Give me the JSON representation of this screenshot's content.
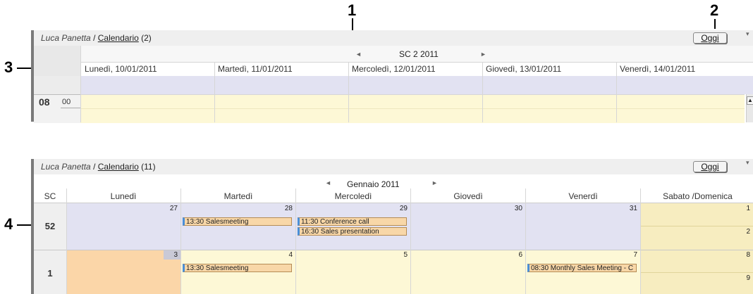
{
  "callouts": {
    "c1": "1",
    "c2": "2",
    "c3": "3",
    "c4": "4"
  },
  "top_panel": {
    "user": "Luca Panetta",
    "separator": " / ",
    "calendar_link": "Calendario",
    "count": "(2)",
    "today_button": "Oggi",
    "period": "SC 2 2011",
    "days": [
      "Lunedì, 10/01/2011",
      "Martedì, 11/01/2011",
      "Mercoledì, 12/01/2011",
      "Giovedì, 13/01/2011",
      "Venerdì, 14/01/2011"
    ],
    "hour": "08",
    "minute": "00"
  },
  "bottom_panel": {
    "user": "Luca Panetta",
    "separator": " / ",
    "calendar_link": "Calendario",
    "count": "(11)",
    "today_button": "Oggi",
    "period": "Gennaio 2011",
    "week_col_label": "SC",
    "day_headers": [
      "Lunedì",
      "Martedì",
      "Mercoledì",
      "Giovedì",
      "Venerdì",
      "Sabato /Domenica"
    ],
    "weeks": [
      {
        "week": "52",
        "days": [
          "27",
          "28",
          "29",
          "30",
          "31"
        ],
        "sat": "1",
        "sun": "2"
      },
      {
        "week": "1",
        "days": [
          "3",
          "4",
          "5",
          "6",
          "7"
        ],
        "sat": "8",
        "sun": "9"
      }
    ],
    "events": {
      "w52_tue": "13:30 Salesmeeting",
      "w52_wed_1": "11:30 Conference call",
      "w52_wed_2": "16:30 Sales presentation",
      "w1_tue": "13:30 Salesmeeting",
      "w1_fri": "08:30 Monthly Sales Meeting - C"
    }
  },
  "colors": {
    "lavender": "#e2e2f2",
    "pale_yellow": "#fdf8d6",
    "weekend_yellow": "#f7edc0",
    "today_orange": "#fbd6a8",
    "event_fill": "#f8d7a8",
    "event_bar": "#4a8fd8"
  }
}
